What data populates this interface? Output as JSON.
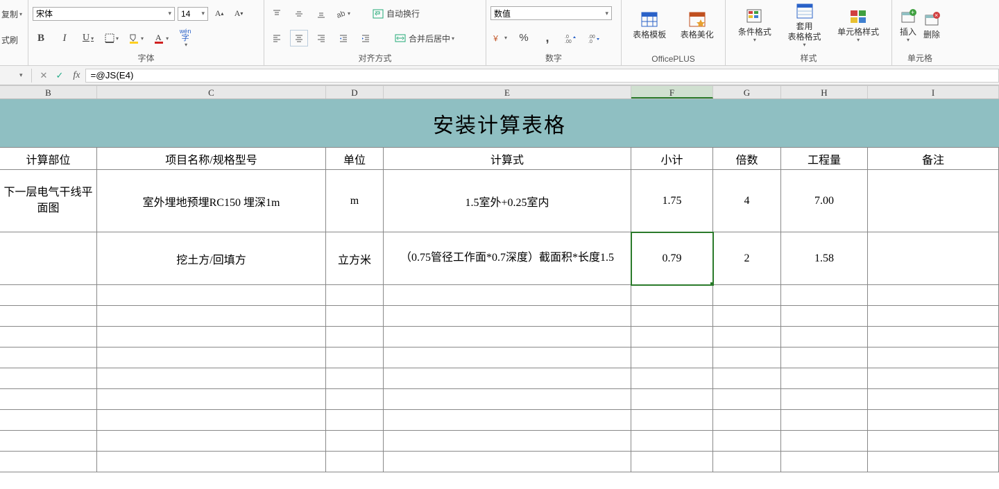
{
  "ribbon": {
    "copy_label": "复制",
    "format_painter": "式刷",
    "font_group_label": "字体",
    "font_name": "宋体",
    "font_size": "14",
    "wenzi_label": "wén\n字",
    "align_group_label": "对齐方式",
    "wrap_text": "自动换行",
    "merge_center": "合并后居中",
    "number_group_label": "数字",
    "number_format": "数值",
    "percent": "%",
    "comma": ",",
    "officeplus_label": "OfficePLUS",
    "table_template": "表格模板",
    "table_beautify": "表格美化",
    "styles_group_label": "样式",
    "cond_format": "条件格式",
    "apply_table_format": "套用\n表格格式",
    "cell_style": "单元格样式",
    "cells_group_label": "单元格",
    "insert": "插入",
    "delete": "删除"
  },
  "formula_bar": {
    "formula": "=@JS(E4)"
  },
  "columns": [
    "B",
    "C",
    "D",
    "E",
    "F",
    "G",
    "H",
    "I"
  ],
  "sheet": {
    "title": "安装计算表格",
    "headers": {
      "b": "计算部位",
      "c": "项目名称/规格型号",
      "d": "单位",
      "e": "计算式",
      "f": "小计",
      "g": "倍数",
      "h": "工程量",
      "i": "备注"
    },
    "rows": [
      {
        "b": "下一层电气干线平面图",
        "c": "室外埋地预埋RC150 埋深1m",
        "d": "m",
        "e": "1.5室外+0.25室内",
        "f": "1.75",
        "g": "4",
        "h": "7.00",
        "i": ""
      },
      {
        "b": "",
        "c": "挖土方/回填方",
        "d": "立方米",
        "e": "（0.75管径工作面*0.7深度）截面积*长度1.5",
        "f": "0.79",
        "g": "2",
        "h": "1.58",
        "i": ""
      }
    ]
  },
  "selected_cell": "F4"
}
